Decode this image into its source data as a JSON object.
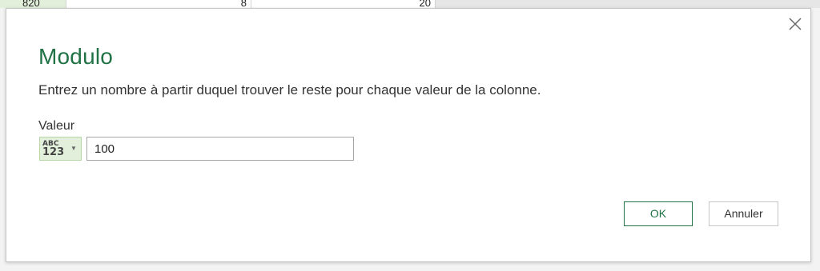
{
  "background": {
    "cells": [
      "820",
      "8",
      "20"
    ]
  },
  "dialog": {
    "title": "Modulo",
    "description": "Entrez un nombre à partir duquel trouver le reste pour chaque valeur de la colonne.",
    "field_label": "Valeur",
    "type_selector": {
      "line1": "ABC",
      "line2": "123"
    },
    "value": "100",
    "ok_label": "OK",
    "cancel_label": "Annuler",
    "close_icon": "close-icon"
  },
  "colors": {
    "accent": "#217346",
    "type_bg": "#e2efda"
  }
}
